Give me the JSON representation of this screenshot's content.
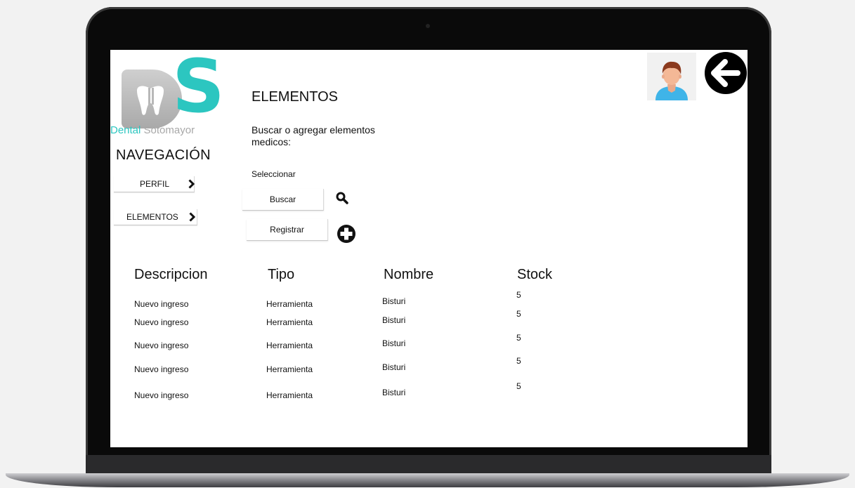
{
  "brand": {
    "part1": "Dental",
    "part2": "Sotomayor"
  },
  "nav": {
    "title": "NAVEGACIÓN",
    "items": [
      {
        "label": "PERFIL"
      },
      {
        "label": "ELEMENTOS"
      }
    ]
  },
  "main": {
    "title": "ELEMENTOS",
    "description": "Buscar o agregar elementos medicos:",
    "select_label": "Seleccionar",
    "search_button": "Buscar",
    "register_button": "Registrar"
  },
  "table": {
    "headers": [
      "Descripcion",
      "Tipo",
      "Nombre",
      "Stock"
    ],
    "rows": [
      [
        "Nuevo ingreso",
        "Herramienta",
        "Bisturi",
        "5"
      ],
      [
        "Nuevo ingreso",
        "Herramienta",
        "Bisturi",
        "5"
      ],
      [
        "Nuevo ingreso",
        "Herramienta",
        "Bisturi",
        "5"
      ],
      [
        "Nuevo ingreso",
        "Herramienta",
        "Bisturi",
        "5"
      ],
      [
        "Nuevo ingreso",
        "Herramienta",
        "Bisturi",
        "5"
      ]
    ]
  },
  "icons": {
    "user": "user-avatar-icon",
    "back": "arrow-left-icon",
    "search": "search-icon",
    "add": "plus-circle-icon",
    "chevron": "chevron-right-icon"
  },
  "colors": {
    "brand_teal": "#2cc6c0",
    "brand_gray": "#a8a8a8"
  }
}
